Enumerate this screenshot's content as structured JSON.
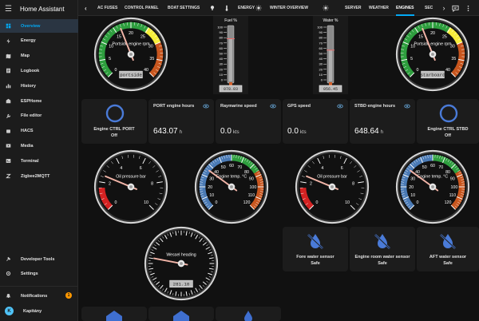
{
  "app_title": "Home Assistant",
  "sidebar": {
    "items": [
      {
        "label": "Overview",
        "icon": "view-dashboard-icon",
        "active": true
      },
      {
        "label": "Energy",
        "icon": "lightning-icon"
      },
      {
        "label": "Map",
        "icon": "map-icon"
      },
      {
        "label": "Logbook",
        "icon": "logbook-icon"
      },
      {
        "label": "History",
        "icon": "chart-bar-icon"
      },
      {
        "label": "ESPHome",
        "icon": "esphome-icon"
      },
      {
        "label": "File editor",
        "icon": "wrench-icon"
      },
      {
        "label": "HACS",
        "icon": "hacs-icon"
      },
      {
        "label": "Media",
        "icon": "media-icon"
      },
      {
        "label": "Terminal",
        "icon": "terminal-icon"
      },
      {
        "label": "Zigbee2MQTT",
        "icon": "zigbee-icon"
      }
    ],
    "bottom": [
      {
        "label": "Developer Tools",
        "icon": "hammer-icon"
      },
      {
        "label": "Settings",
        "icon": "gear-icon"
      }
    ],
    "notifications_label": "Notifications",
    "notifications_count": "1",
    "user_name": "Kapitány",
    "user_initial": "K"
  },
  "tabs": [
    {
      "label": "AC FUSES"
    },
    {
      "label": "CONTROL PANEL"
    },
    {
      "label": "BOAT SETTINGS"
    },
    {
      "label": "ENERGY"
    },
    {
      "label": "WINTER OVERVIEW"
    },
    {
      "label": "SERVER"
    },
    {
      "label": "WEATHER"
    },
    {
      "label": "ENGINES",
      "active": true
    },
    {
      "label": "SEC"
    }
  ],
  "gauges": {
    "port_rpm": {
      "label": "Portside engine rpm",
      "sub": "portside",
      "ticks": [
        "0",
        "5",
        "10",
        "15",
        "20",
        "25",
        "30",
        "35",
        "40"
      ],
      "value_fraction": 0.42
    },
    "stbd_rpm": {
      "label": "Portside engine rpm",
      "sub": "starboard",
      "ticks": [
        "0",
        "5",
        "10",
        "15",
        "20",
        "25",
        "30",
        "35",
        "40"
      ],
      "value_fraction": 0.42
    },
    "oil_port": {
      "label": "Oil pressure bar",
      "ticks": [
        "0",
        "2",
        "4",
        "6",
        "8",
        "10"
      ],
      "value_fraction": 0.25
    },
    "temp_port": {
      "label": "Engine temp. °C",
      "ticks": [
        "0",
        "10",
        "20",
        "30",
        "40",
        "50",
        "60",
        "70",
        "80",
        "90",
        "100",
        "110",
        "120"
      ],
      "value_fraction": 0.3
    },
    "oil_stbd": {
      "label": "Oil pressure bar",
      "ticks": [
        "0",
        "2",
        "4",
        "6",
        "8",
        "10"
      ],
      "value_fraction": 0.25
    },
    "temp_stbd": {
      "label": "Engine temp. °C",
      "ticks": [
        "0",
        "10",
        "20",
        "30",
        "40",
        "50",
        "60",
        "70",
        "80",
        "90",
        "100",
        "110",
        "120"
      ],
      "value_fraction": 0.3
    },
    "heading": {
      "label": "Wessel heading",
      "value": "281.10",
      "value_fraction": 0.78
    }
  },
  "thermos": {
    "fuel": {
      "label": "Fuel %",
      "value": "078.03",
      "level": 78.03,
      "ticks": [
        "100",
        "90",
        "80",
        "70",
        "60",
        "50",
        "40",
        "30",
        "20",
        "10",
        "0"
      ]
    },
    "water": {
      "label": "Water %",
      "value": "056.45",
      "level": 56.45,
      "ticks": [
        "100",
        "90",
        "80",
        "70",
        "60",
        "50",
        "40",
        "30",
        "20",
        "10",
        "0"
      ]
    }
  },
  "engine_port_card": {
    "label": "Engine CTRL PORT",
    "state": "Off"
  },
  "engine_stbd_card": {
    "label": "Engine CTRL STBD",
    "state": "Off"
  },
  "stats": [
    {
      "title": "PORT engine hours",
      "value": "643.07",
      "unit": "h"
    },
    {
      "title": "Raymarine speed",
      "value": "0.0",
      "unit": "kts"
    },
    {
      "title": "GPS speed",
      "value": "0.0",
      "unit": "kts"
    },
    {
      "title": "STBD engine hours",
      "value": "648.64",
      "unit": "h"
    }
  ],
  "water_sensors": [
    {
      "label": "Fore water sensor",
      "state": "Safe"
    },
    {
      "label": "Engine room water sensor",
      "state": "Safe"
    },
    {
      "label": "AFT water sensor",
      "state": "Safe"
    }
  ],
  "colors": {
    "accent": "#03a9f4",
    "green": "#2e9e3e",
    "yellow": "#f6ee3a",
    "orange": "#c8561e",
    "red": "#d42222",
    "blue": "#4a7ab5"
  }
}
